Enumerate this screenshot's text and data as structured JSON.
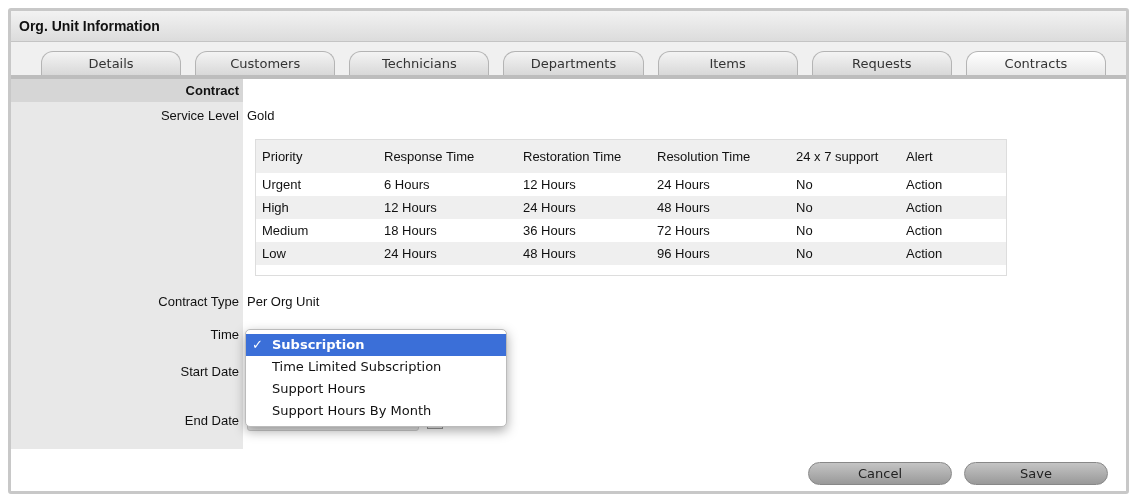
{
  "panel": {
    "title": "Org. Unit Information"
  },
  "tabs": [
    {
      "label": "Details",
      "selected": false
    },
    {
      "label": "Customers",
      "selected": false
    },
    {
      "label": "Technicians",
      "selected": false
    },
    {
      "label": "Departments",
      "selected": false
    },
    {
      "label": "Items",
      "selected": false
    },
    {
      "label": "Requests",
      "selected": false
    },
    {
      "label": "Contracts",
      "selected": true
    }
  ],
  "section": {
    "heading": "Contract"
  },
  "service_level": {
    "label": "Service Level",
    "value": "Gold"
  },
  "table": {
    "columns": [
      "Priority",
      "Response Time",
      "Restoration Time",
      "Resolution Time",
      "24 x 7 support",
      "Alert"
    ],
    "rows": [
      [
        "Urgent",
        "6 Hours",
        "12 Hours",
        "24 Hours",
        "No",
        "Action"
      ],
      [
        "High",
        "12 Hours",
        "24 Hours",
        "48 Hours",
        "No",
        "Action"
      ],
      [
        "Medium",
        "18 Hours",
        "36 Hours",
        "72 Hours",
        "No",
        "Action"
      ],
      [
        "Low",
        "24 Hours",
        "48 Hours",
        "96 Hours",
        "No",
        "Action"
      ]
    ]
  },
  "contract_type": {
    "label": "Contract Type",
    "value": "Per Org Unit"
  },
  "time": {
    "label": "Time"
  },
  "start_date": {
    "label": "Start Date"
  },
  "end_date": {
    "label": "End Date"
  },
  "dropdown": {
    "check": "✓",
    "options": [
      {
        "label": "Subscription",
        "selected": true
      },
      {
        "label": "Time Limited Subscription",
        "selected": false
      },
      {
        "label": "Support Hours",
        "selected": false
      },
      {
        "label": "Support Hours By Month",
        "selected": false
      }
    ]
  },
  "buttons": [
    {
      "label": "Cancel"
    },
    {
      "label": "Save"
    }
  ]
}
